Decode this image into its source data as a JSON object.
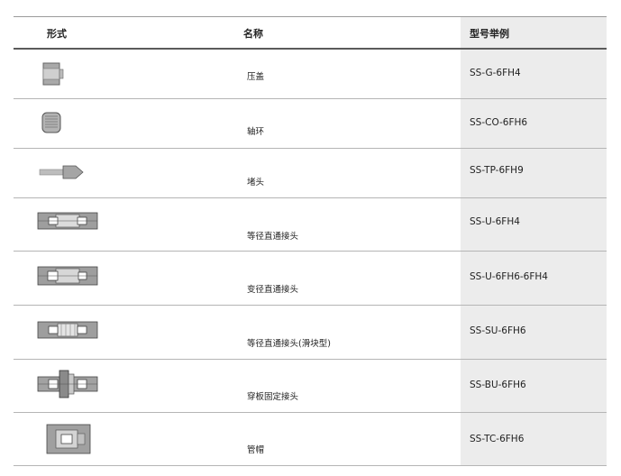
{
  "header": {
    "col_form": "形式",
    "col_name": "名称",
    "col_model": "型号举例"
  },
  "rows": [
    {
      "icon": "cap-nut-icon",
      "name": "压盖",
      "model": "SS-G-6FH4"
    },
    {
      "icon": "collar-icon",
      "name": "轴环",
      "model": "SS-CO-6FH6"
    },
    {
      "icon": "plug-icon",
      "name": "堵头",
      "model": "SS-TP-6FH9"
    },
    {
      "icon": "union-icon",
      "name": "等径直通接头",
      "model": "SS-U-6FH4"
    },
    {
      "icon": "reducing-union-icon",
      "name": "变径直通接头",
      "model": "SS-U-6FH6-6FH4"
    },
    {
      "icon": "slip-union-icon",
      "name": "等径直通接头(滑块型)",
      "model": "SS-SU-6FH6"
    },
    {
      "icon": "bulkhead-union-icon",
      "name": "穿板固定接头",
      "model": "SS-BU-6FH6"
    },
    {
      "icon": "tube-cap-icon",
      "name": "管帽",
      "model": "SS-TC-6FH6"
    }
  ]
}
